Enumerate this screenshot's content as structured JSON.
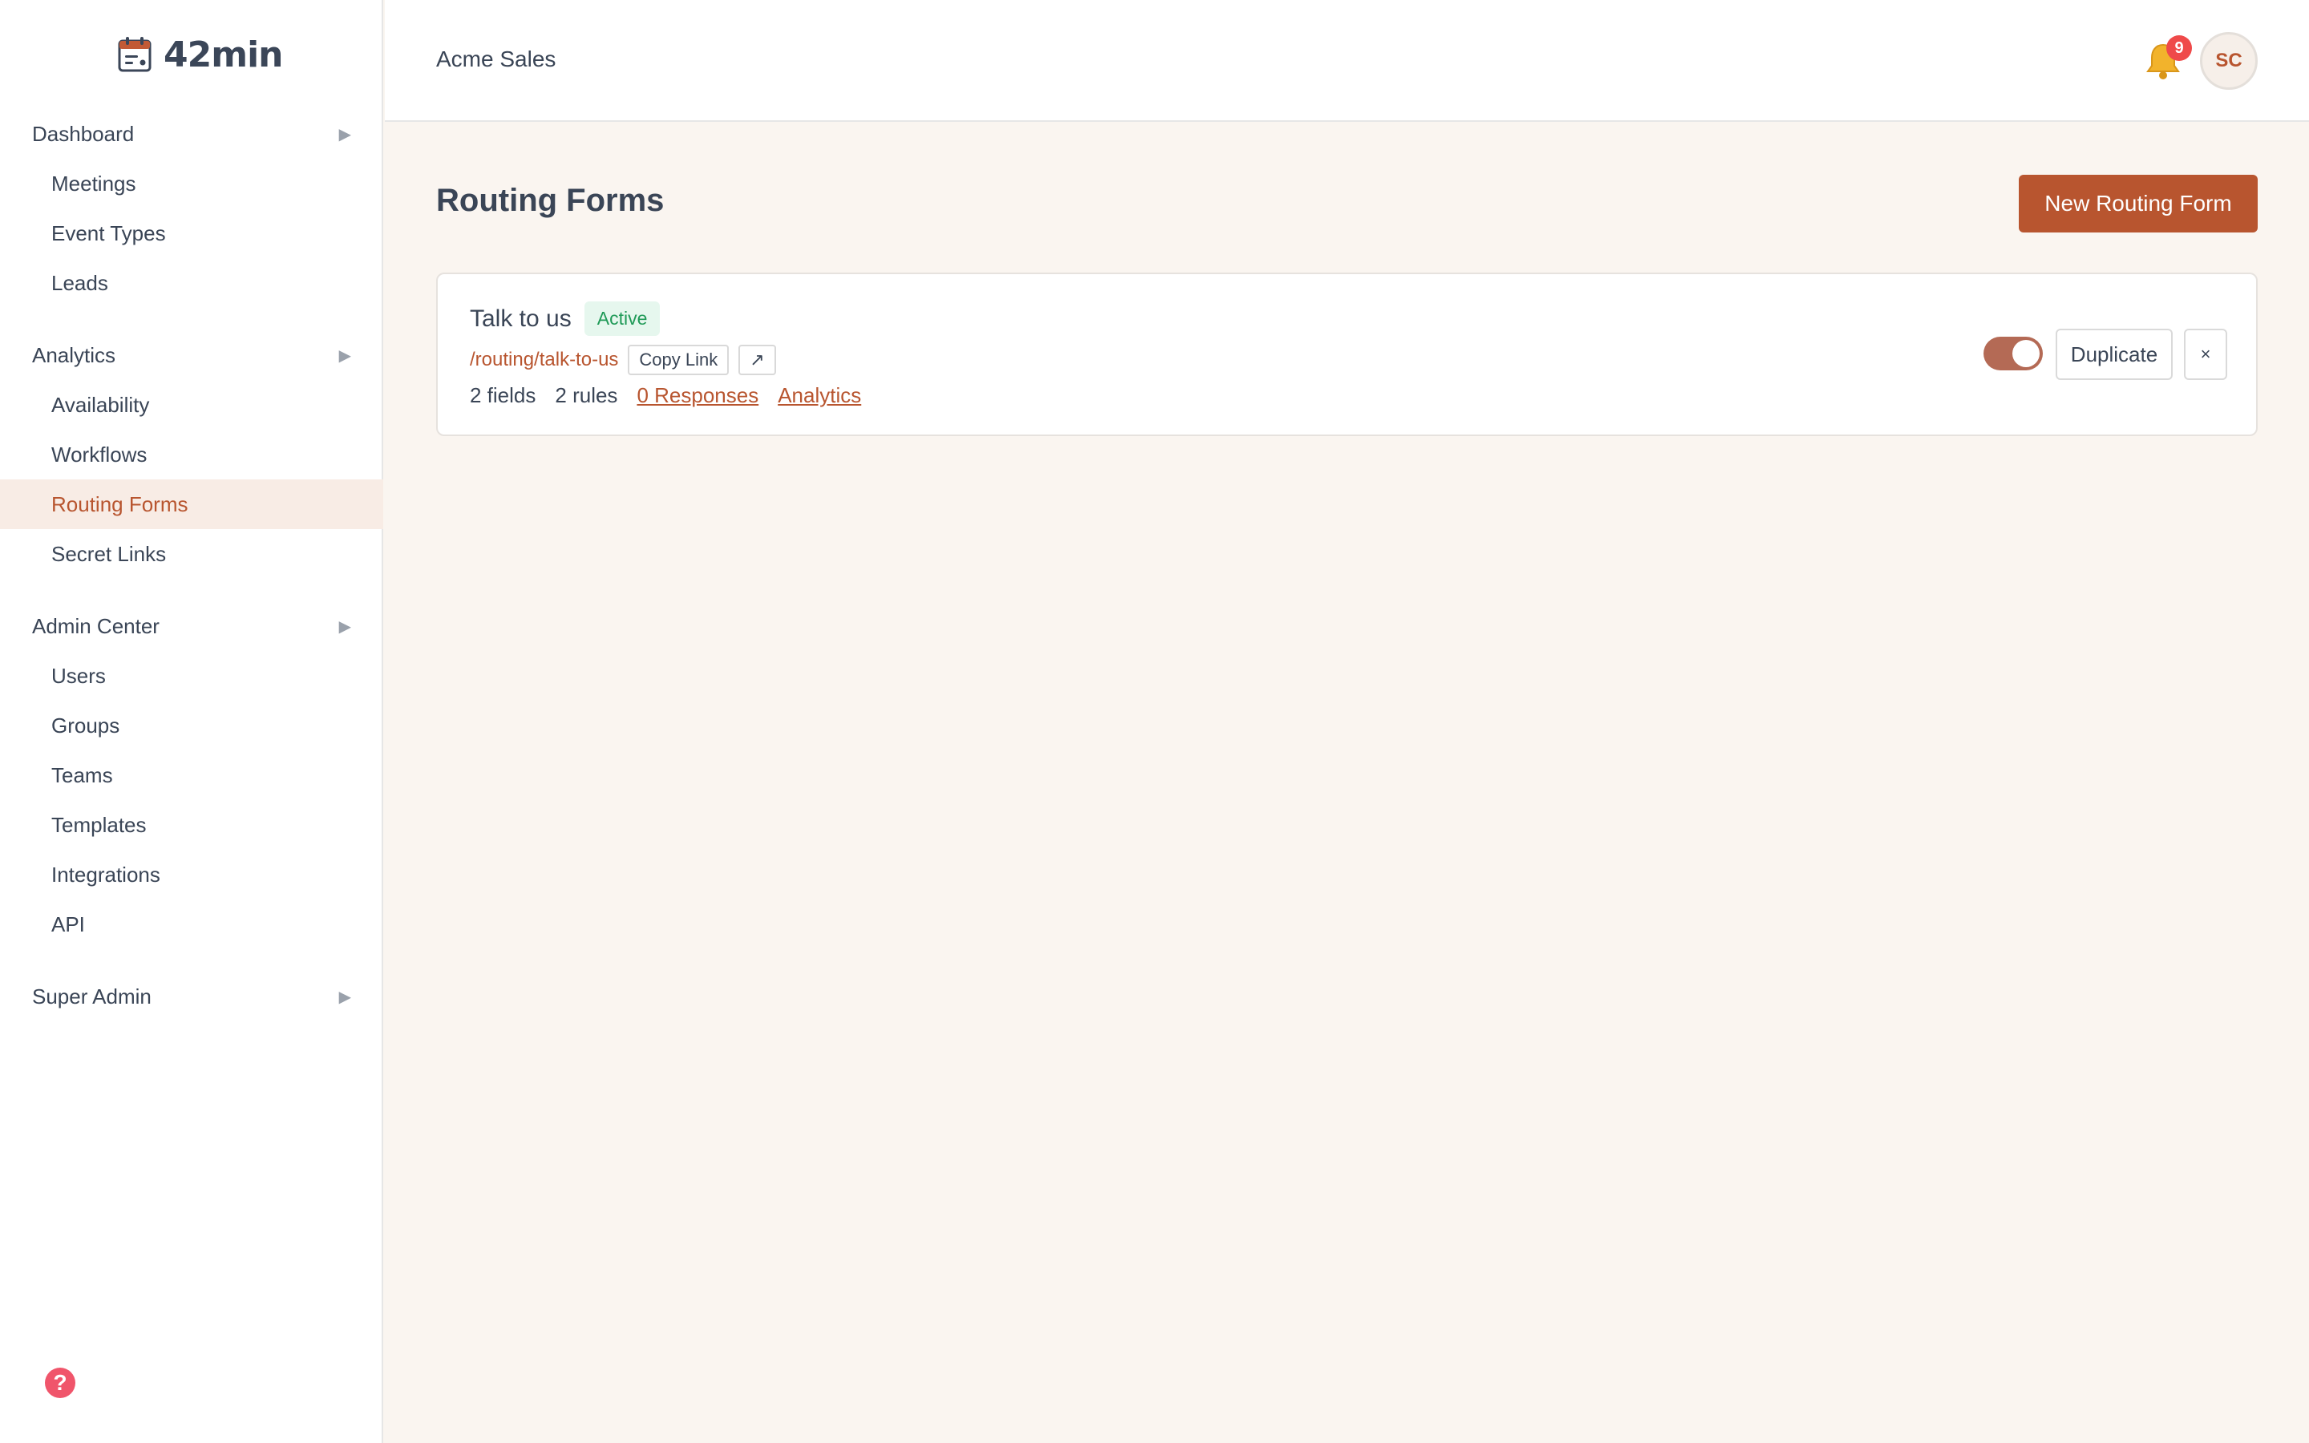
{
  "app": {
    "logo_text": "42min"
  },
  "sidebar": {
    "groups": [
      {
        "label": "Dashboard",
        "arrow": "▶"
      },
      {
        "label": "Analytics",
        "arrow": "▶"
      },
      {
        "label": "Admin Center",
        "arrow": "▶"
      },
      {
        "label": "Super Admin",
        "arrow": "▶"
      }
    ],
    "dashboard_items": [
      "Meetings",
      "Event Types",
      "Leads"
    ],
    "analytics_items": [
      "Availability",
      "Workflows",
      "Routing Forms",
      "Secret Links"
    ],
    "admin_items": [
      "Users",
      "Groups",
      "Teams",
      "Templates",
      "Integrations",
      "API"
    ],
    "active_item": "Routing Forms",
    "help_glyph": "?"
  },
  "topbar": {
    "org_name": "Acme Sales",
    "notification_count": "9",
    "avatar_initials": "SC"
  },
  "main": {
    "title": "Routing Forms",
    "new_button_label": "New Routing Form",
    "forms": [
      {
        "name": "Talk to us",
        "status": "Active",
        "path": "/routing/talk-to-us",
        "copy_label": "Copy Link",
        "open_label": "↗",
        "fields": "2 fields",
        "rules": "2 rules",
        "responses_label": "0 Responses",
        "analytics_label": "Analytics",
        "enabled": true,
        "duplicate_label": "Duplicate",
        "delete_label": "×"
      }
    ]
  },
  "colors": {
    "accent": "#b8552f",
    "active_bg": "#f8ece5",
    "badge_green": "#1f9a57",
    "notif_red": "#ef4a4a"
  }
}
